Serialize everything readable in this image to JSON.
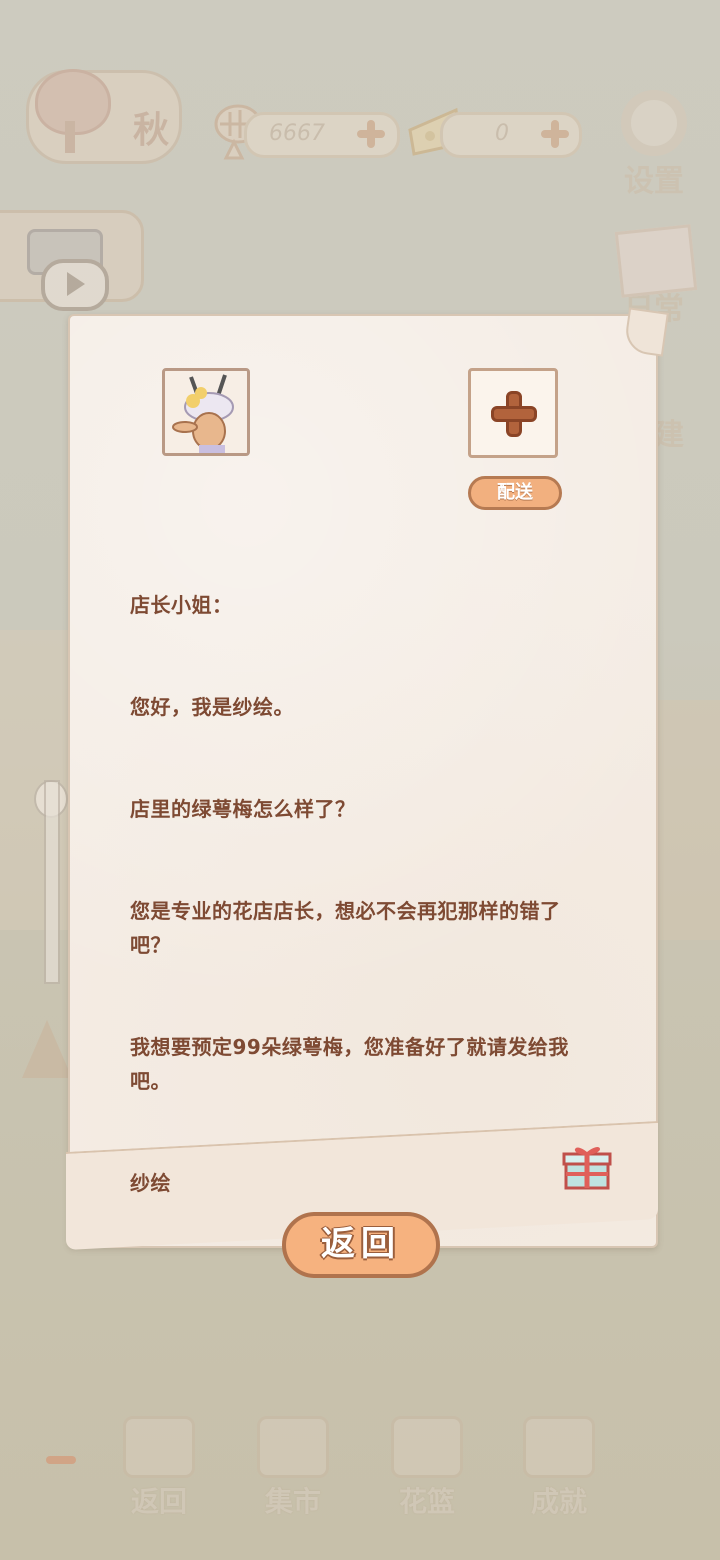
{
  "topbar": {
    "season": "秋",
    "fish_count": "6667",
    "cheese_count": "0",
    "settings_label": "设置"
  },
  "side": {
    "daily_label": "日常",
    "build_label": "建"
  },
  "letter": {
    "deliver_label": "配送",
    "lines": [
      "店长小姐：",
      "您好，我是纱绘。",
      "店里的绿萼梅怎么样了？",
      "您是专业的花店店长，想必不会再犯那样的错了吧？",
      "我想要预定99朵绿萼梅，您准备好了就请发给我吧。",
      "纱绘"
    ]
  },
  "back_label": "返回",
  "bottom_nav": [
    {
      "label": "返回",
      "icon": "window-icon"
    },
    {
      "label": "集市",
      "icon": "market-stall-icon"
    },
    {
      "label": "花篮",
      "icon": "flower-basket-icon"
    },
    {
      "label": "成就",
      "icon": "trophy-icon"
    }
  ],
  "colors": {
    "accent": "#f6b27f",
    "text": "#7e4a33",
    "paper": "#f4ece4"
  }
}
